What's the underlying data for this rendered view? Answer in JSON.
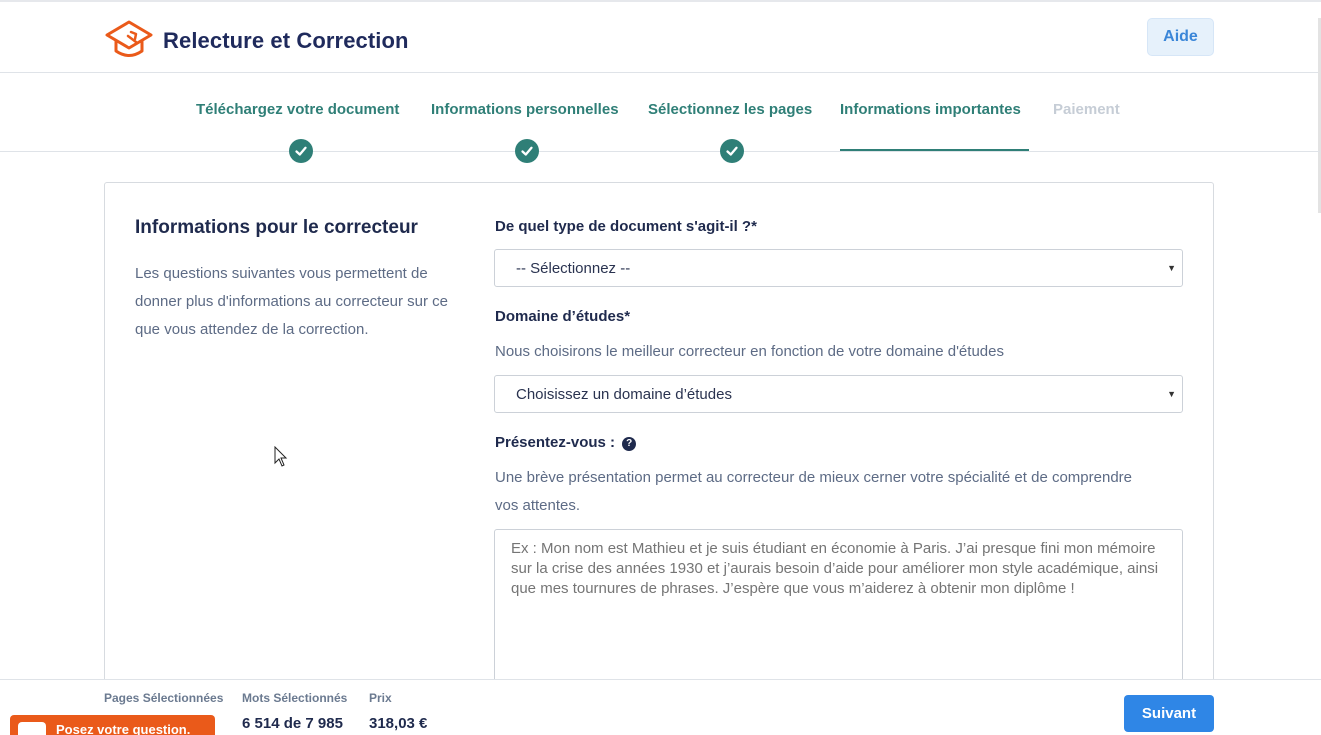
{
  "header": {
    "app_title": "Relecture et Correction",
    "help_label": "Aide"
  },
  "steps": [
    {
      "label": "Téléchargez votre document",
      "status": "done"
    },
    {
      "label": "Informations personnelles",
      "status": "done"
    },
    {
      "label": "Sélectionnez les pages",
      "status": "done"
    },
    {
      "label": "Informations importantes",
      "status": "active"
    },
    {
      "label": "Paiement",
      "status": "disabled"
    }
  ],
  "sidebar": {
    "title": "Informations pour le correcteur",
    "description": "Les questions suivantes vous permettent de donner plus d'informations au correcteur sur ce que vous attendez de la correction."
  },
  "form": {
    "doc_type_label": "De quel type de document s'agit-il ?*",
    "doc_type_value": "-- Sélectionnez --",
    "domain_label": "Domaine d’études*",
    "domain_hint": "Nous choisirons le meilleur correcteur en fonction de votre domaine d'études",
    "domain_value": "Choisissez un domaine d’études",
    "intro_label": "Présentez-vous :",
    "intro_help_icon": "?",
    "intro_hint": "Une brève présentation permet au correcteur de mieux cerner votre spécialité et de comprendre vos attentes.",
    "intro_placeholder": "Ex : Mon nom est Mathieu et je suis étudiant en économie à Paris. J’ai presque fini mon mémoire sur la crise des années 1930 et j’aurais besoin d’aide pour améliorer mon style académique, ainsi que mes tournures de phrases. J’espère que vous m’aiderez à obtenir mon diplôme !"
  },
  "footer": {
    "pages_label": "Pages Sélectionnées",
    "words_label": "Mots Sélectionnés",
    "words_value": "6 514 de 7 985",
    "price_label": "Prix",
    "price_value": "318,03 €",
    "next_label": "Suivant",
    "chat_label": "Posez votre question."
  },
  "colors": {
    "brand_orange": "#ea5a1a",
    "step_green": "#2f7f77",
    "primary_blue": "#2f86e6",
    "title_navy": "#1f2a5c"
  }
}
